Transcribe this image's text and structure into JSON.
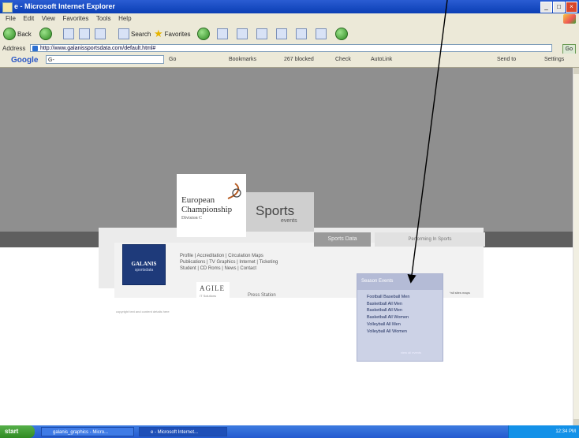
{
  "window": {
    "title": "e - Microsoft Internet Explorer",
    "controls": [
      "_",
      "□",
      "×"
    ]
  },
  "menu": [
    "File",
    "Edit",
    "View",
    "Favorites",
    "Tools",
    "Help"
  ],
  "toolbar": {
    "back": "Back",
    "search": "Search",
    "favorites": "Favorites"
  },
  "address": {
    "label": "Address",
    "url": "http://www.galanissportsdata.com/default.html#",
    "go": "Go"
  },
  "google": {
    "logo": "Google",
    "input": "G-",
    "go": "Go",
    "bookmarks": "Bookmarks",
    "blocked": "267 blocked",
    "check": "Check",
    "autolink": "AutoLink",
    "sendto": "Send to",
    "settings": "Settings"
  },
  "page": {
    "logo_line1": "European",
    "logo_line2": "Championship",
    "logo_line3": "Division C",
    "sports": "Sports",
    "events": "events",
    "galanis_title": "GALANIS",
    "galanis_sub": "sportsdata",
    "nav_line1": "Profile | Accreditation | Circulation Maps",
    "nav_line2": "Publications | TV Graphics | Internet | Ticketing",
    "nav_line3": "Student | CD Roms | News | Contact",
    "agile": "AGILE",
    "agile_sub": "IT Solutions",
    "press": "Press Station",
    "footer": "copyright text and content details here",
    "tab_sports_data": "Sports Data",
    "tab_performing": "Performing In Sports",
    "season_title": "Season Events",
    "season_items": [
      "Football  Baseball  Men",
      "Basketball  All  Men",
      "Basketball  All  Men",
      "Basketball  All  Women",
      "Volleyball  All  Men",
      "Volleyball  All  Women"
    ],
    "season_footer": "view all events",
    "other_note": "*all sites maps"
  },
  "taskbar": {
    "start": "start",
    "task1": "galanis_graphics - Micro...",
    "task2": "e - Microsoft Internet...",
    "clock": "12:34 PM"
  }
}
